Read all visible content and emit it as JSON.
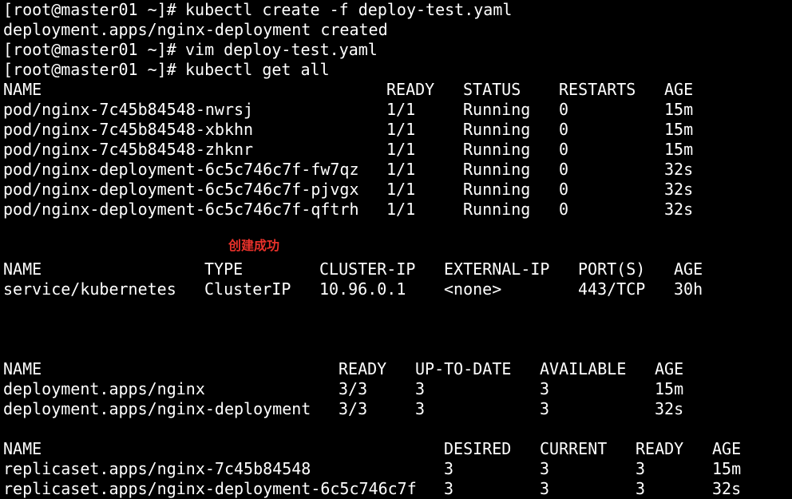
{
  "commands": [
    {
      "prompt": "[root@master01 ~]#",
      "command": "kubectl create -f deploy-test.yaml"
    },
    {
      "output": "deployment.apps/nginx-deployment created"
    },
    {
      "prompt": "[root@master01 ~]#",
      "command": "vim deploy-test.yaml"
    },
    {
      "prompt": "[root@master01 ~]#",
      "command": "kubectl get all"
    }
  ],
  "pods": {
    "headers": [
      "NAME",
      "READY",
      "STATUS",
      "RESTARTS",
      "AGE"
    ],
    "rows": [
      [
        "pod/nginx-7c45b84548-nwrsj",
        "1/1",
        "Running",
        "0",
        "15m"
      ],
      [
        "pod/nginx-7c45b84548-xbkhn",
        "1/1",
        "Running",
        "0",
        "15m"
      ],
      [
        "pod/nginx-7c45b84548-zhknr",
        "1/1",
        "Running",
        "0",
        "15m"
      ],
      [
        "pod/nginx-deployment-6c5c746c7f-fw7qz",
        "1/1",
        "Running",
        "0",
        "32s"
      ],
      [
        "pod/nginx-deployment-6c5c746c7f-pjvgx",
        "1/1",
        "Running",
        "0",
        "32s"
      ],
      [
        "pod/nginx-deployment-6c5c746c7f-qftrh",
        "1/1",
        "Running",
        "0",
        "32s"
      ]
    ]
  },
  "annotation": {
    "text": "创建成功",
    "color": "#e8312a"
  },
  "services": {
    "headers": [
      "NAME",
      "TYPE",
      "CLUSTER-IP",
      "EXTERNAL-IP",
      "PORT(S)",
      "AGE"
    ],
    "rows": [
      [
        "service/kubernetes",
        "ClusterIP",
        "10.96.0.1",
        "<none>",
        "443/TCP",
        "30h"
      ]
    ]
  },
  "deployments": {
    "headers": [
      "NAME",
      "READY",
      "UP-TO-DATE",
      "AVAILABLE",
      "AGE"
    ],
    "rows": [
      [
        "deployment.apps/nginx",
        "3/3",
        "3",
        "3",
        "15m"
      ],
      [
        "deployment.apps/nginx-deployment",
        "3/3",
        "3",
        "3",
        "32s"
      ]
    ]
  },
  "replicasets": {
    "headers": [
      "NAME",
      "DESIRED",
      "CURRENT",
      "READY",
      "AGE"
    ],
    "rows": [
      [
        "replicaset.apps/nginx-7c45b84548",
        "3",
        "3",
        "3",
        "15m"
      ],
      [
        "replicaset.apps/nginx-deployment-6c5c746c7f",
        "3",
        "3",
        "3",
        "32s"
      ]
    ]
  },
  "colors": {
    "background": "#000000",
    "text": "#ffffff",
    "annotation": "#e8312a"
  }
}
